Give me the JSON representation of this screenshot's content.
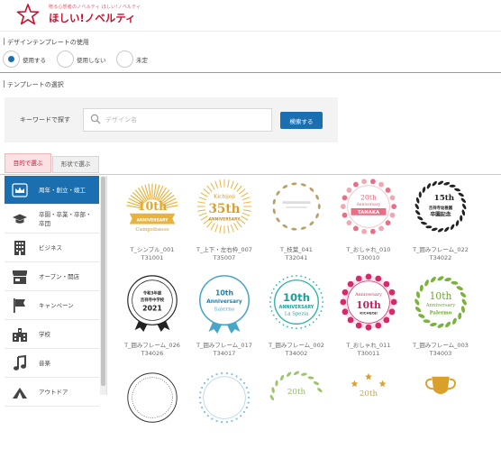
{
  "header": {
    "logo_tagline": "贈る心想者のノベルティ ほしい!ノベルティ",
    "logo_text": "ほしい!ノベルティ",
    "colors": {
      "brand": "#c8102e",
      "accent": "#1a6fb0"
    }
  },
  "template_use": {
    "title": "デザインテンプレートの使用",
    "options": [
      {
        "label": "使用する",
        "selected": true
      },
      {
        "label": "使用しない",
        "selected": false
      },
      {
        "label": "未定",
        "selected": false
      }
    ]
  },
  "template_select": {
    "title": "テンプレートの選択",
    "keyword_label": "キーワードで探す",
    "search_placeholder": "デザイン名",
    "search_value": "",
    "search_button": "検索する",
    "tabs": [
      {
        "label": "目的で選ぶ",
        "active": true
      },
      {
        "label": "形状で選ぶ",
        "active": false
      }
    ]
  },
  "sidebar": [
    {
      "label": "周年・創立・竣工",
      "icon": "crown-icon",
      "active": true
    },
    {
      "label": "卒園・卒業・卒部・卒団",
      "icon": "graduation-cap-icon",
      "active": false
    },
    {
      "label": "ビジネス",
      "icon": "building-icon",
      "active": false
    },
    {
      "label": "オープン・開店",
      "icon": "shop-icon",
      "active": false
    },
    {
      "label": "キャンペーン",
      "icon": "flag-icon",
      "active": false
    },
    {
      "label": "学校",
      "icon": "school-icon",
      "active": false
    },
    {
      "label": "音楽",
      "icon": "music-note-icon",
      "active": false
    },
    {
      "label": "アウトドア",
      "icon": "outdoor-icon",
      "active": false
    }
  ],
  "templates": [
    {
      "name": "T_シンプル_001",
      "code": "T31001",
      "badge_lines": [
        "10th",
        "Campobasso"
      ],
      "style": "sunburst"
    },
    {
      "name": "T_上下・左右枠_007",
      "code": "T35007",
      "badge_lines": [
        "Kichijoji",
        "35th",
        "ANNIVERSARY"
      ],
      "style": "rays"
    },
    {
      "name": "T_枝葉_041",
      "code": "T32041",
      "badge_lines": [],
      "style": "leaves"
    },
    {
      "name": "T_おしゃれ_010",
      "code": "T30010",
      "badge_lines": [
        "20th",
        "Anniversary",
        "TANAKA"
      ],
      "style": "floral"
    },
    {
      "name": "T_囲みフレーム_022",
      "code": "T34022",
      "badge_lines": [
        "15th",
        "吉祥寺幼稚園",
        "卒園記念"
      ],
      "style": "wreath"
    },
    {
      "name": "T_囲みフレーム_026",
      "code": "T34026",
      "badge_lines": [
        "令和3年度",
        "吉祥寺中学校",
        "2021"
      ],
      "style": "ribbon"
    },
    {
      "name": "T_囲みフレーム_017",
      "code": "T34017",
      "badge_lines": [
        "10th",
        "Anniversary",
        "Salerno"
      ],
      "style": "blue-ribbon"
    },
    {
      "name": "T_囲みフレーム_002",
      "code": "T34002",
      "badge_lines": [
        "10th",
        "ANNIVERSARY",
        "La Spezia"
      ],
      "style": "teal-ring"
    },
    {
      "name": "T_おしゃれ_011",
      "code": "T30011",
      "badge_lines": [
        "10th",
        "Anniversary",
        "KICHIJOJI"
      ],
      "style": "magenta"
    },
    {
      "name": "T_囲みフレーム_003",
      "code": "T34003",
      "badge_lines": [
        "10th",
        "Anniversary",
        "Palermo"
      ],
      "style": "green-wreath"
    },
    {
      "name": "",
      "code": "",
      "badge_lines": [],
      "style": "partial-1"
    },
    {
      "name": "",
      "code": "",
      "badge_lines": [],
      "style": "partial-2"
    },
    {
      "name": "",
      "code": "",
      "badge_lines": [
        "20th"
      ],
      "style": "partial-3"
    },
    {
      "name": "",
      "code": "",
      "badge_lines": [
        "20th"
      ],
      "style": "partial-4"
    },
    {
      "name": "",
      "code": "",
      "badge_lines": [],
      "style": "trophy"
    }
  ]
}
